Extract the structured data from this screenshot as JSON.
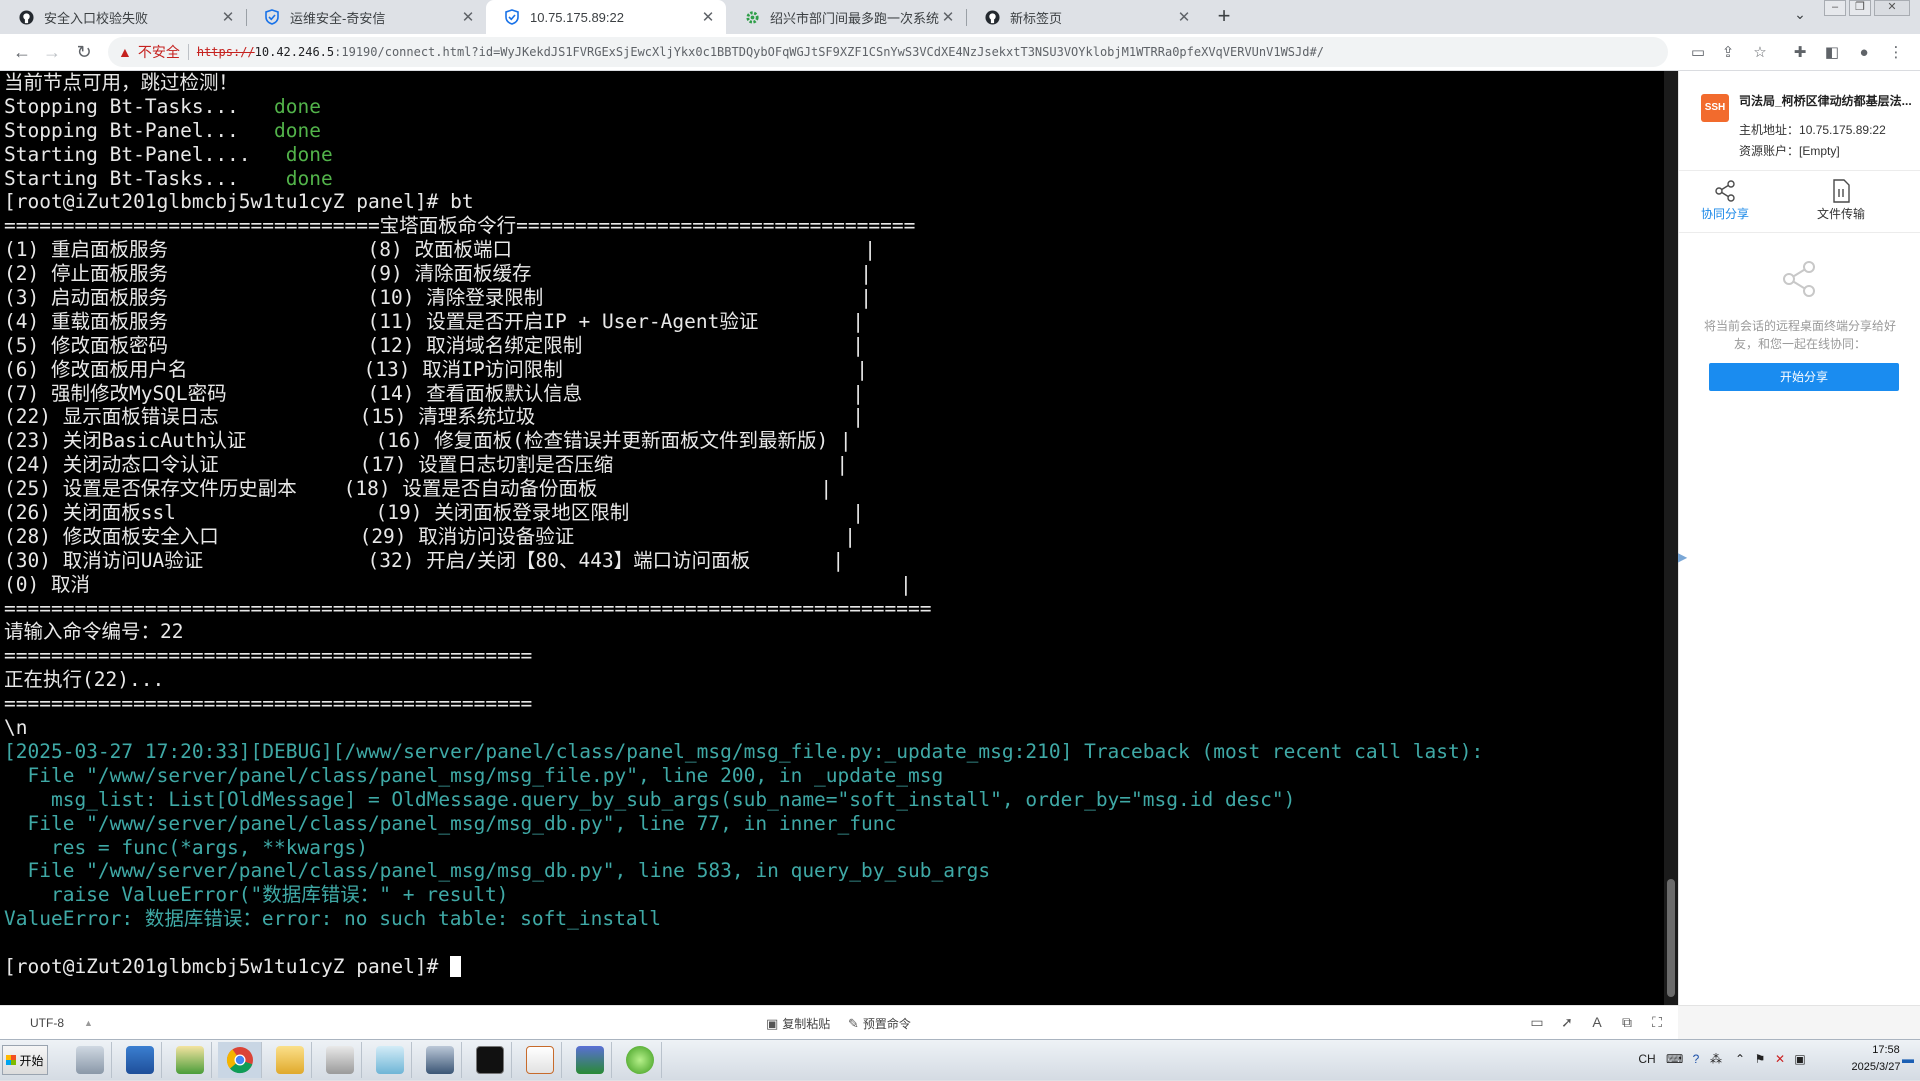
{
  "browser": {
    "tabs": [
      {
        "title": "安全入口校验失败",
        "icon": "github-icon",
        "active": false
      },
      {
        "title": "运维安全-奇安信",
        "icon": "shield-icon",
        "active": false
      },
      {
        "title": "10.75.175.89:22",
        "icon": "shield-icon",
        "active": true
      },
      {
        "title": "绍兴市部门间最多跑一次系统",
        "icon": "gear-icon",
        "active": false
      },
      {
        "title": "新标签页",
        "icon": "github-icon",
        "active": false
      }
    ],
    "new_tab_symbol": "+",
    "address": {
      "security_label": "不安全",
      "scheme": "https://",
      "host": "10.42.246.5",
      "path": ":19190/connect.html?id=WyJKekdJS1FVRGExSjEwcXljYkx0c1BBTDQybOFqWGJtSF9XZF1CSnYwS3VCdXE4NzJsekxtT3NSU3VOYklobjM1WTRRa0pfeXVqVERVUnV1WSJd#/"
    }
  },
  "terminal": {
    "lines": [
      {
        "text": "当前节点可用，跳过检测！"
      },
      {
        "text": "Stopping Bt-Tasks...   ",
        "status": "done"
      },
      {
        "text": "Stopping Bt-Panel...   ",
        "status": "done"
      },
      {
        "text": "Starting Bt-Panel....   ",
        "status": "done"
      },
      {
        "text": "Starting Bt-Tasks...    ",
        "status": "done"
      },
      {
        "text": "[root@iZut201glbmcbj5w1tu1cyZ panel]# bt"
      },
      {
        "text": "================================宝塔面板命令行=================================="
      },
      {
        "text": "(1) 重启面板服务                 (8) 改面板端口                              |"
      },
      {
        "text": "(2) 停止面板服务                 (9) 清除面板缓存                            |"
      },
      {
        "text": "(3) 启动面板服务                 (10) 清除登录限制                           |"
      },
      {
        "text": "(4) 重载面板服务                 (11) 设置是否开启IP + User-Agent验证        |"
      },
      {
        "text": "(5) 修改面板密码                 (12) 取消域名绑定限制                       |"
      },
      {
        "text": "(6) 修改面板用户名               (13) 取消IP访问限制                         |"
      },
      {
        "text": "(7) 强制修改MySQL密码            (14) 查看面板默认信息                       |"
      },
      {
        "text": "(22) 显示面板错误日志            (15) 清理系统垃圾                           |"
      },
      {
        "text": "(23) 关闭BasicAuth认证           (16) 修复面板(检查错误并更新面板文件到最新版) |"
      },
      {
        "text": "(24) 关闭动态口令认证            (17) 设置日志切割是否压缩                   |"
      },
      {
        "text": "(25) 设置是否保存文件历史副本    (18) 设置是否自动备份面板                   |"
      },
      {
        "text": "(26) 关闭面板ssl                 (19) 关闭面板登录地区限制                   |"
      },
      {
        "text": "(28) 修改面板安全入口            (29) 取消访问设备验证                       |"
      },
      {
        "text": "(30) 取消访问UA验证              (32) 开启/关闭【80、443】端口访问面板       |"
      },
      {
        "text": "(0) 取消                                                                     |"
      },
      {
        "text": "==============================================================================="
      },
      {
        "text": "请输入命令编号：22"
      },
      {
        "text": "============================================="
      },
      {
        "text": "正在执行(22)..."
      },
      {
        "text": "============================================="
      },
      {
        "text": "\\n"
      },
      {
        "text": "[2025-03-27 17:20:33][DEBUG][/www/server/panel/class/panel_msg/msg_file.py:_update_msg:210] Traceback (most recent call last):",
        "style": "cy"
      },
      {
        "text": "  File \"/www/server/panel/class/panel_msg/msg_file.py\", line 200, in _update_msg",
        "style": "cy"
      },
      {
        "text": "    msg_list: List[OldMessage] = OldMessage.query_by_sub_args(sub_name=\"soft_install\", order_by=\"msg.id desc\")",
        "style": "cy"
      },
      {
        "text": "  File \"/www/server/panel/class/panel_msg/msg_db.py\", line 77, in inner_func",
        "style": "cy"
      },
      {
        "text": "    res = func(*args, **kwargs)",
        "style": "cy"
      },
      {
        "text": "  File \"/www/server/panel/class/panel_msg/msg_db.py\", line 583, in query_by_sub_args",
        "style": "cy"
      },
      {
        "text": "    raise ValueError(\"数据库错误：\" + result)",
        "style": "cy"
      },
      {
        "text": "ValueError: 数据库错误：error: no such table: soft_install",
        "style": "cy"
      },
      {
        "text": ""
      },
      {
        "text": "[root@iZut201glbmcbj5w1tu1cyZ panel]# ",
        "cursor": true
      }
    ]
  },
  "side_panel": {
    "badge": "SSH",
    "session_title": "司法局_柯桥区律动纺都基层法...",
    "host_label": "主机地址：",
    "host_value": "10.75.175.89:22",
    "account_label": "资源账户：",
    "account_value": "[Empty]",
    "actions": [
      {
        "label": "协同分享",
        "icon": "share-icon",
        "active": true
      },
      {
        "label": "文件传输",
        "icon": "file-icon",
        "active": false
      }
    ],
    "share_description": "将当前会话的远程桌面终端分享给好友，和您一起在线协同：",
    "start_share_label": "开始分享"
  },
  "status_bar": {
    "encoding": "UTF-8",
    "copy_paste_label": "复制粘贴",
    "preset_cmd_label": "预置命令"
  },
  "taskbar": {
    "start_label": "开始",
    "tray_lang": "CH",
    "clock_time": "17:58",
    "clock_date": "2025/3/27"
  }
}
